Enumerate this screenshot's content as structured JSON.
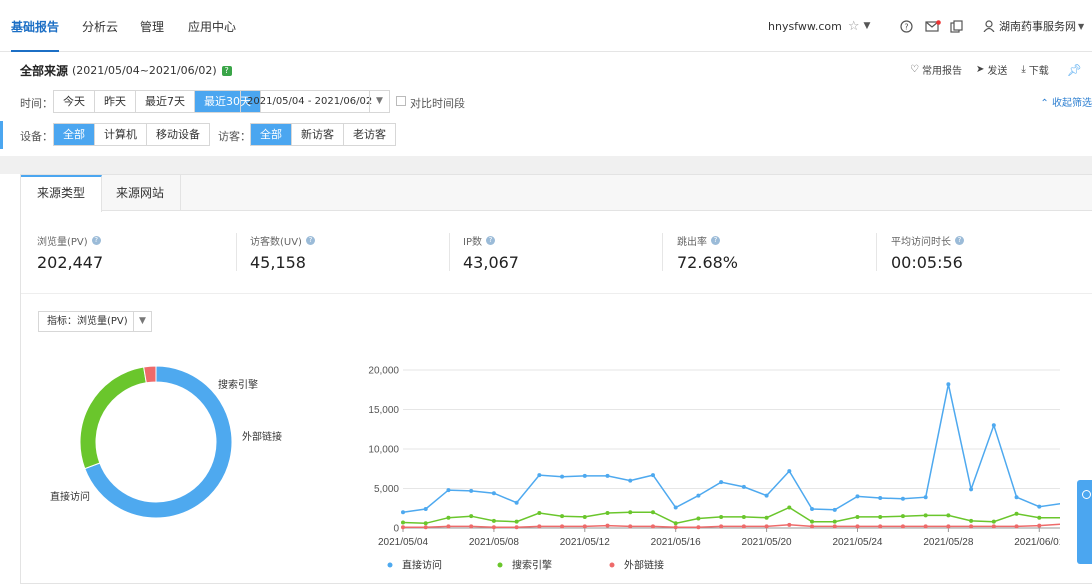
{
  "nav": {
    "tabs": [
      "基础报告",
      "分析云",
      "管理",
      "应用中心"
    ],
    "site": "hnysfww.com",
    "user": "湖南药事服务网"
  },
  "filter": {
    "title": "全部来源",
    "date_range_text": "(2021/05/04~2021/06/02)",
    "help_badge": "?",
    "actions": [
      "常用报告",
      "发送",
      "下载"
    ],
    "time_label": "时间：",
    "time_options": [
      "今天",
      "昨天",
      "最近7天",
      "最近30天"
    ],
    "time_selected": 3,
    "date_input": "2021/05/04 - 2021/06/02",
    "compare_label": "对比时间段",
    "collapse_label": "收起筛选",
    "device_label": "设备：",
    "device_options": [
      "全部",
      "计算机",
      "移动设备"
    ],
    "device_selected": 0,
    "visitor_label": "访客：",
    "visitor_options": [
      "全部",
      "新访客",
      "老访客"
    ],
    "visitor_selected": 0
  },
  "panel": {
    "tabs": [
      "来源类型",
      "来源网站"
    ],
    "active_tab": 0,
    "metrics": [
      {
        "name": "浏览量(PV)",
        "value": "202,447"
      },
      {
        "name": "访客数(UV)",
        "value": "45,158"
      },
      {
        "name": "IP数",
        "value": "43,067"
      },
      {
        "name": "跳出率",
        "value": "72.68%"
      },
      {
        "name": "平均访问时长",
        "value": "00:05:56"
      }
    ],
    "selector_label": "指标：",
    "selector_value": "浏览量(PV)"
  },
  "colors": {
    "accent": "#4ba6f0",
    "nav_active": "#1c6fc5",
    "direct": "#4ea9ef",
    "search": "#6ac62c",
    "external": "#ee6a6a"
  },
  "chart_data": [
    {
      "type": "pie",
      "style": "donut",
      "labels": [
        "直接访问",
        "搜索引擎",
        "外部链接"
      ],
      "values": [
        140300,
        56900,
        5247
      ]
    },
    {
      "type": "line",
      "x": [
        "2021/05/04",
        "2021/05/05",
        "2021/05/06",
        "2021/05/07",
        "2021/05/08",
        "2021/05/09",
        "2021/05/10",
        "2021/05/11",
        "2021/05/12",
        "2021/05/13",
        "2021/05/14",
        "2021/05/15",
        "2021/05/16",
        "2021/05/17",
        "2021/05/18",
        "2021/05/19",
        "2021/05/20",
        "2021/05/21",
        "2021/05/22",
        "2021/05/23",
        "2021/05/24",
        "2021/05/25",
        "2021/05/26",
        "2021/05/27",
        "2021/05/28",
        "2021/05/29",
        "2021/05/30",
        "2021/05/31",
        "2021/06/01",
        "2021/06/02"
      ],
      "x_tick_labels": [
        "2021/05/04",
        "2021/05/08",
        "2021/05/12",
        "2021/05/16",
        "2021/05/20",
        "2021/05/24",
        "2021/05/28",
        "2021/06/01"
      ],
      "ylim": [
        0,
        20000
      ],
      "y_ticks": [
        "0",
        "5,000",
        "10,000",
        "15,000",
        "20,000"
      ],
      "legend_position": "bottom",
      "series": [
        {
          "name": "直接访问",
          "values": [
            2000,
            2400,
            4800,
            4700,
            4400,
            3200,
            6700,
            6500,
            6600,
            6600,
            6000,
            6700,
            2600,
            4100,
            5800,
            5200,
            4100,
            7200,
            2400,
            2300,
            4000,
            3800,
            3700,
            3900,
            18200,
            4900,
            13000,
            3900,
            2700,
            3100
          ]
        },
        {
          "name": "搜索引擎",
          "values": [
            700,
            600,
            1300,
            1500,
            900,
            800,
            1900,
            1500,
            1400,
            1900,
            2000,
            2000,
            600,
            1200,
            1400,
            1400,
            1300,
            2600,
            800,
            800,
            1400,
            1400,
            1500,
            1600,
            1600,
            900,
            800,
            1800,
            1300,
            1300
          ]
        },
        {
          "name": "外部链接",
          "values": [
            100,
            100,
            200,
            200,
            100,
            100,
            200,
            200,
            200,
            300,
            200,
            200,
            100,
            100,
            200,
            200,
            200,
            400,
            200,
            200,
            200,
            200,
            200,
            200,
            200,
            200,
            200,
            200,
            300,
            500
          ]
        }
      ]
    }
  ]
}
